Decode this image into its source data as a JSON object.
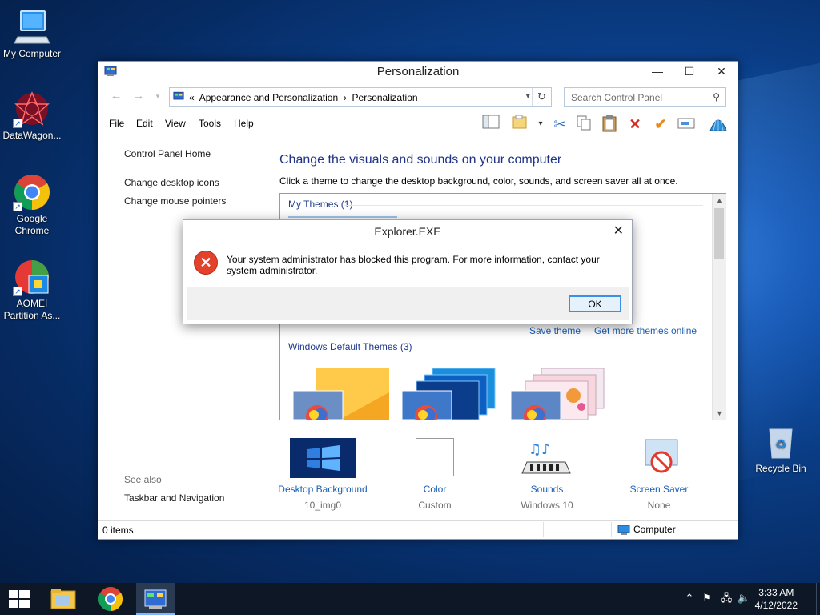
{
  "desktop": {
    "icons": [
      {
        "label": "My Computer"
      },
      {
        "label": "DataWagon..."
      },
      {
        "label": "Google Chrome"
      },
      {
        "label": "AOMEI Partition As..."
      },
      {
        "label": "Recycle Bin"
      }
    ]
  },
  "window": {
    "title": "Personalization",
    "controls": {
      "minimize": "—",
      "maximize": "☐",
      "close": "✕"
    },
    "address": {
      "prefix": "«",
      "path": [
        "Appearance and Personalization",
        "Personalization"
      ],
      "separator": "›"
    },
    "search": {
      "placeholder": "Search Control Panel"
    },
    "menu": [
      "File",
      "Edit",
      "View",
      "Tools",
      "Help"
    ],
    "sidebar": {
      "home": "Control Panel Home",
      "links": [
        "Change desktop icons",
        "Change mouse pointers"
      ],
      "see_also": "See also",
      "see_also_links": [
        "Taskbar and Navigation"
      ]
    },
    "content": {
      "heading": "Change the visuals and sounds on your computer",
      "subtext": "Click a theme to change the desktop background, color, sounds, and screen saver all at once.",
      "my_themes": "My Themes (1)",
      "save_theme": "Save theme",
      "get_more": "Get more themes online",
      "default_themes": "Windows Default Themes (3)"
    },
    "bottom": [
      {
        "label": "Desktop Background",
        "value": "10_img0"
      },
      {
        "label": "Color",
        "value": "Custom"
      },
      {
        "label": "Sounds",
        "value": "Windows 10"
      },
      {
        "label": "Screen Saver",
        "value": "None"
      }
    ],
    "status": {
      "items": "0 items",
      "location": "Computer"
    }
  },
  "dialog": {
    "title": "Explorer.EXE",
    "message": "Your system administrator has blocked this program. For more information, contact your system administrator.",
    "ok": "OK"
  },
  "taskbar": {
    "time": "3:33 AM",
    "date": "4/12/2022"
  },
  "colors": {
    "accent": "#1a5fb4",
    "heading": "#1e3287",
    "error": "#e3412b",
    "taskbar": "#0d1726"
  }
}
